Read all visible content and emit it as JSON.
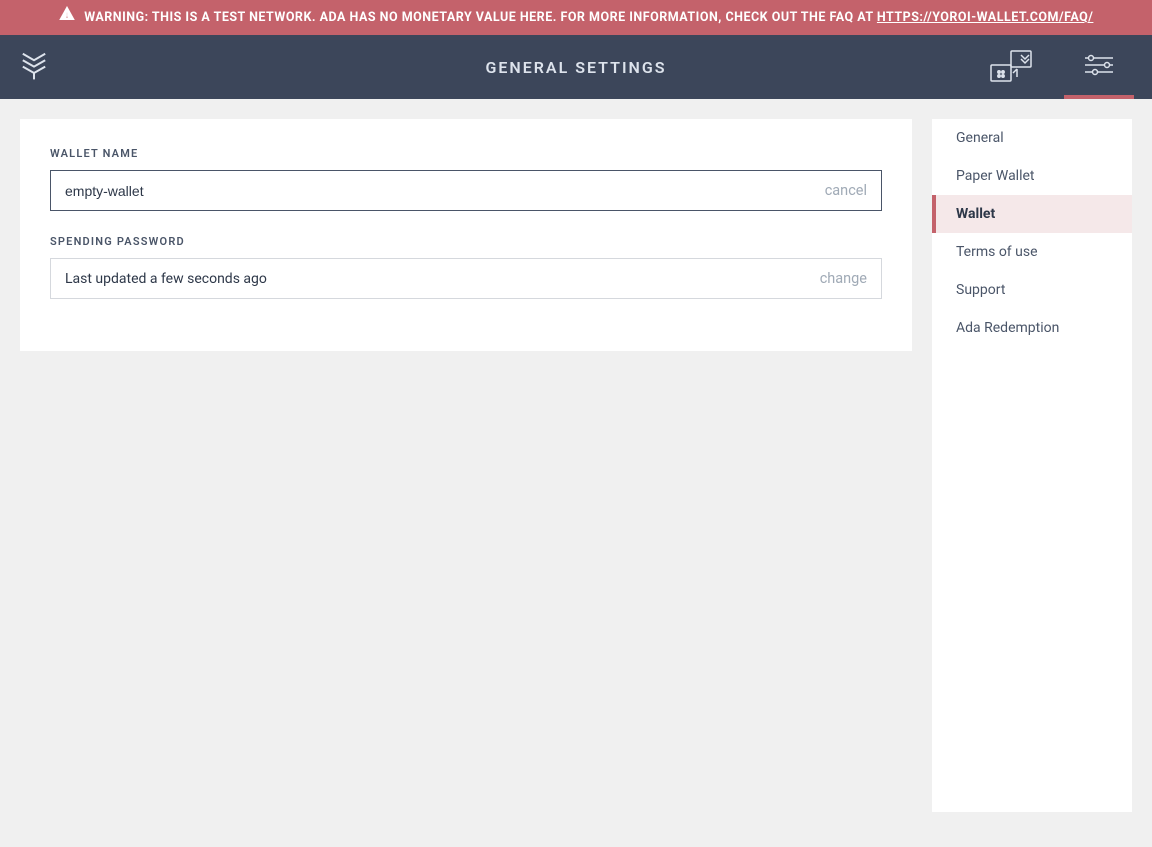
{
  "warning": {
    "prefix": "WARNING: THIS IS A TEST NETWORK. ADA HAS NO MONETARY VALUE HERE. FOR MORE INFORMATION, CHECK OUT THE FAQ AT ",
    "link_text": "HTTPS://YOROI-WALLET.COM/FAQ/"
  },
  "topbar": {
    "title": "GENERAL SETTINGS"
  },
  "form": {
    "wallet_name_label": "WALLET NAME",
    "wallet_name_value": "empty-wallet",
    "wallet_name_action": "cancel",
    "password_label": "SPENDING PASSWORD",
    "password_status": "Last updated a few seconds ago",
    "password_action": "change"
  },
  "sidebar": {
    "items": [
      {
        "label": "General",
        "active": false
      },
      {
        "label": "Paper Wallet",
        "active": false
      },
      {
        "label": "Wallet",
        "active": true
      },
      {
        "label": "Terms of use",
        "active": false
      },
      {
        "label": "Support",
        "active": false
      },
      {
        "label": "Ada Redemption",
        "active": false
      }
    ]
  }
}
